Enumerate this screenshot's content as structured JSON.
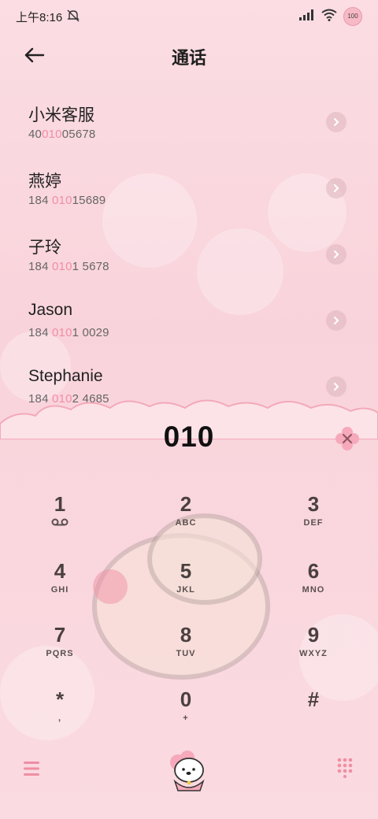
{
  "status": {
    "time": "上午8:16",
    "battery": "100"
  },
  "header": {
    "title": "通话"
  },
  "contacts": [
    {
      "name": "小米客服",
      "num_pre": "40",
      "num_hl": "010",
      "num_post": "05678"
    },
    {
      "name": "燕婷",
      "num_pre": "184 ",
      "num_hl": "010",
      "num_post": "15689"
    },
    {
      "name": "子玲",
      "num_pre": "184 ",
      "num_hl": "010",
      "num_post": "1 5678"
    },
    {
      "name": "Jason",
      "num_pre": "184 ",
      "num_hl": "010",
      "num_post": "1 0029"
    },
    {
      "name": "Stephanie",
      "num_pre": "184 ",
      "num_hl": "010",
      "num_post": "2 4685"
    }
  ],
  "dialer": {
    "display": "010"
  },
  "keys": [
    {
      "digit": "1",
      "sub": ""
    },
    {
      "digit": "2",
      "sub": "ABC"
    },
    {
      "digit": "3",
      "sub": "DEF"
    },
    {
      "digit": "4",
      "sub": "GHI"
    },
    {
      "digit": "5",
      "sub": "JKL"
    },
    {
      "digit": "6",
      "sub": "MNO"
    },
    {
      "digit": "7",
      "sub": "PQRS"
    },
    {
      "digit": "8",
      "sub": "TUV"
    },
    {
      "digit": "9",
      "sub": "WXYZ"
    },
    {
      "digit": "*",
      "sub": ","
    },
    {
      "digit": "0",
      "sub": "+"
    },
    {
      "digit": "#",
      "sub": ""
    }
  ],
  "colors": {
    "accent": "#f28da4",
    "pink_icon": "#f08ea3"
  },
  "icons": {
    "back": "arrow-left-icon",
    "backspace": "flower-backspace-icon",
    "menu": "menu-icon",
    "call": "bear-call-icon",
    "keypad": "keypad-grid-icon"
  }
}
